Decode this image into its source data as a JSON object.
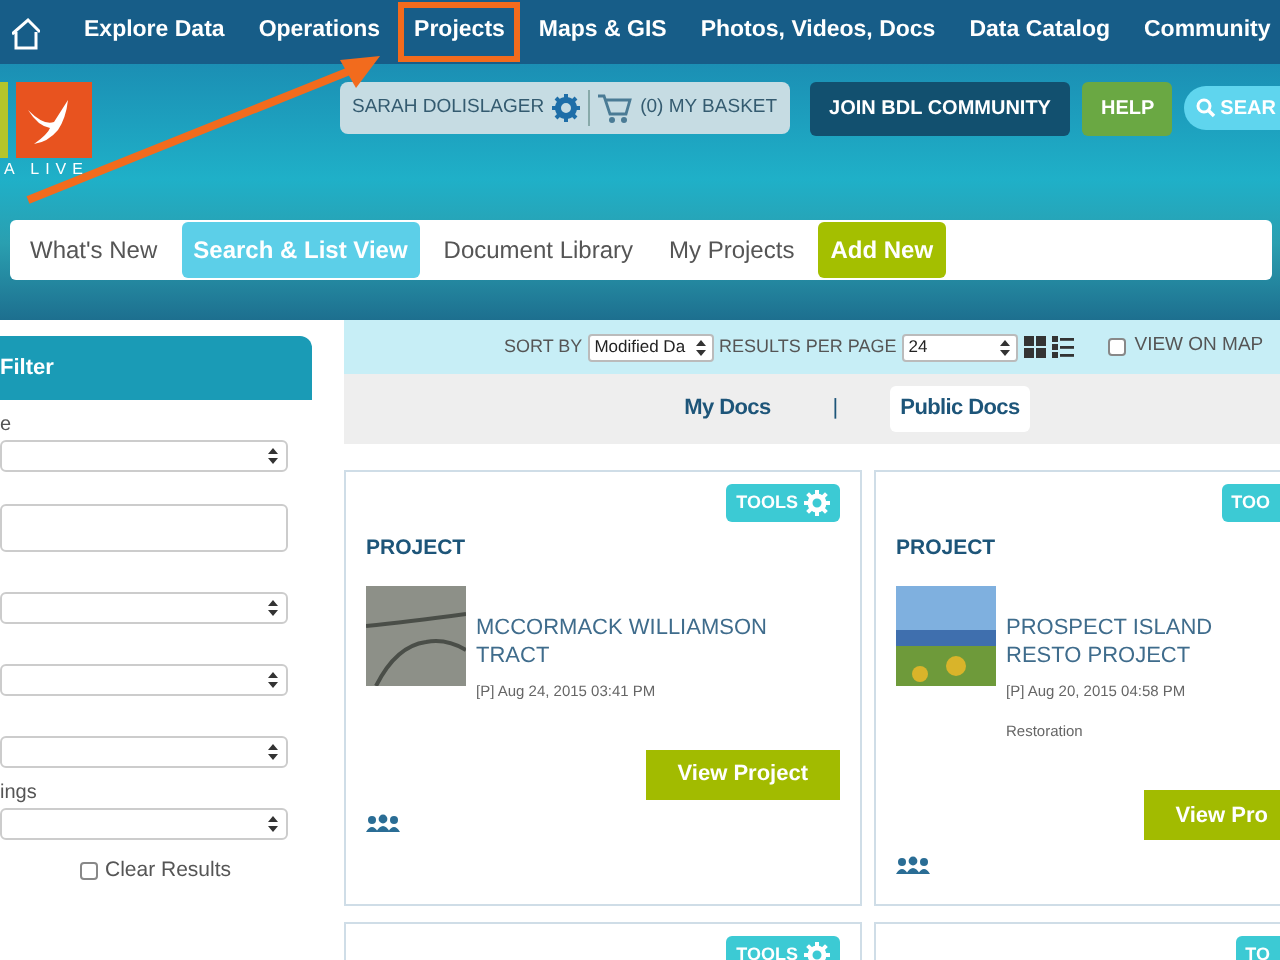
{
  "top_nav": {
    "items": [
      {
        "label": "Explore Data",
        "highlighted": false
      },
      {
        "label": "Operations",
        "highlighted": false
      },
      {
        "label": "Projects",
        "highlighted": true
      },
      {
        "label": "Maps & GIS",
        "highlighted": false
      },
      {
        "label": "Photos, Videos, Docs",
        "highlighted": false
      },
      {
        "label": "Data Catalog",
        "highlighted": false
      },
      {
        "label": "Community",
        "highlighted": false
      }
    ]
  },
  "header": {
    "logo_text": "A LIVE",
    "user_name": "SARAH DOLISLAGER",
    "basket": "(0) MY BASKET",
    "join_button": "JOIN BDL COMMUNITY",
    "help_button": "HELP",
    "search_button": "SEAR"
  },
  "sub_nav": [
    {
      "label": "What's New",
      "kind": "tab",
      "selected": false
    },
    {
      "label": "Search & List View",
      "kind": "tab",
      "selected": true
    },
    {
      "label": "Document Library",
      "kind": "tab",
      "selected": false
    },
    {
      "label": "My Projects",
      "kind": "tab",
      "selected": false
    },
    {
      "label": "Add New",
      "kind": "action"
    }
  ],
  "sidebar": {
    "title": "Filter",
    "fields": [
      {
        "kind": "select",
        "label": "e"
      },
      {
        "kind": "text"
      },
      {
        "kind": "select"
      },
      {
        "kind": "select"
      },
      {
        "kind": "select"
      },
      {
        "kind": "select",
        "label": "ings"
      }
    ],
    "clear_results": {
      "label": "Clear Results",
      "checked": false
    }
  },
  "toolbar": {
    "sort_label": "SORT BY",
    "sort_value": "Modified Da",
    "per_page_label": "RESULTS PER PAGE",
    "per_page_value": "24",
    "view_on_map": {
      "label": "VIEW ON MAP",
      "checked": false
    }
  },
  "doc_tabs": [
    {
      "label": "My Docs",
      "selected": false
    },
    {
      "label": "Public Docs",
      "selected": true
    }
  ],
  "doc_tab_separator": "|",
  "cards": [
    {
      "tools": "TOOLS",
      "type": "PROJECT",
      "title": "MCCORMACK WILLIAMSON TRACT",
      "date": "[P] Aug 24, 2015 03:41 PM",
      "button": "View Project"
    },
    {
      "tools": "TOO",
      "type": "PROJECT",
      "title": "PROSPECT ISLAND RESTO PROJECT",
      "date": "[P] Aug 20, 2015 04:58 PM",
      "tag": "Restoration",
      "button": "View Pro"
    },
    {
      "tools": "TOOLS"
    },
    {
      "tools": "TO"
    }
  ]
}
